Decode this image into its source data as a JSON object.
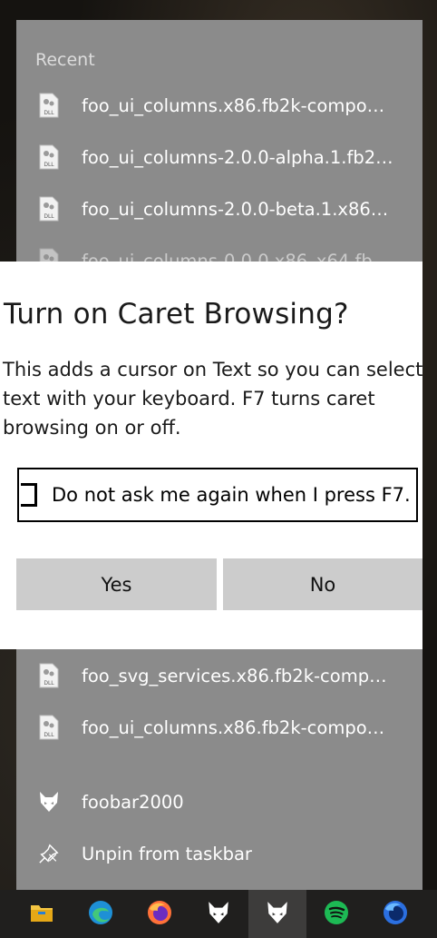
{
  "jumplist": {
    "recent_label": "Recent",
    "recent_items": [
      {
        "label": "foo_ui_columns.x86.fb2k-component",
        "icon": "dll-file-icon"
      },
      {
        "label": "foo_ui_columns-2.0.0-alpha.1.fb2k-...",
        "icon": "dll-file-icon"
      },
      {
        "label": "foo_ui_columns-2.0.0-beta.1.x86-x6...",
        "icon": "dll-file-icon"
      },
      {
        "label": "foo_ui_columns-0.0.0.x86_x64.fb2k...",
        "icon": "dll-file-icon"
      }
    ],
    "lower_items": [
      {
        "label": "foo_svg_services.x86.fb2k-compone...",
        "icon": "dll-file-icon"
      },
      {
        "label": "foo_ui_columns.x86.fb2k-component",
        "icon": "dll-file-icon"
      }
    ],
    "app_item": {
      "label": "foobar2000",
      "icon": "foobar2000-icon"
    },
    "unpin_item": {
      "label": "Unpin from taskbar",
      "icon": "unpin-icon"
    }
  },
  "dialog": {
    "title": "Turn on Caret Browsing?",
    "message": "This adds a cursor on Text so you can select\ntext with your keyboard. F7 turns caret\nbrowsing on or off.",
    "checkbox_label": "Do not ask me again when I press F7.",
    "checkbox_checked": false,
    "yes_label": "Yes",
    "no_label": "No"
  },
  "taskbar": {
    "icons": [
      {
        "name": "file-explorer-icon",
        "active": false
      },
      {
        "name": "edge-icon",
        "active": false
      },
      {
        "name": "firefox-icon",
        "active": false
      },
      {
        "name": "foobar2000-icon",
        "active": false
      },
      {
        "name": "foobar2000-icon",
        "active": true
      },
      {
        "name": "spotify-icon",
        "active": false
      },
      {
        "name": "firefox-nightly-icon",
        "active": false
      }
    ]
  },
  "colors": {
    "jumplist_bg": "#8b8b8b",
    "taskbar_bg": "#201f1e",
    "button_bg": "#cccccc",
    "spotify": "#1db954",
    "edge": "#1e90d6",
    "firefox": "#ff7139",
    "explorer": "#f4c542"
  }
}
